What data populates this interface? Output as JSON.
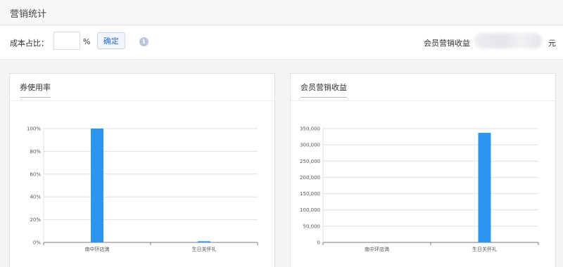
{
  "header": {
    "title": "营销统计"
  },
  "toolbar": {
    "cost_ratio_label": "成本占比：",
    "cost_ratio_value": "",
    "percent_sign": "%",
    "confirm_label": "确定",
    "info_icon": "info-icon",
    "revenue_label": "会员营销收益",
    "revenue_value": "",
    "revenue_unit": "元"
  },
  "colors": {
    "bar": "#2d95f0",
    "accent": "#2a6fcf"
  },
  "chart_data": [
    {
      "type": "bar",
      "title": "券使用率",
      "categories": [
        "南中环店満",
        "生日关怀礼"
      ],
      "values": [
        100,
        1
      ],
      "ylim": [
        0,
        100
      ],
      "yticks": [
        0,
        20,
        40,
        60,
        80,
        100
      ],
      "ytick_labels": [
        "0%",
        "20%",
        "40%",
        "60%",
        "80%",
        "100%"
      ],
      "grid": true
    },
    {
      "type": "bar",
      "title": "会员营销收益",
      "categories": [
        "南中环店満",
        "生日关怀礼"
      ],
      "values": [
        0,
        337000
      ],
      "ylim": [
        0,
        350000
      ],
      "yticks": [
        0,
        50000,
        100000,
        150000,
        200000,
        250000,
        300000,
        350000
      ],
      "ytick_labels": [
        "0",
        "50,000",
        "100,000",
        "150,000",
        "200,000",
        "250,000",
        "300,000",
        "350,000"
      ],
      "grid": true
    }
  ]
}
